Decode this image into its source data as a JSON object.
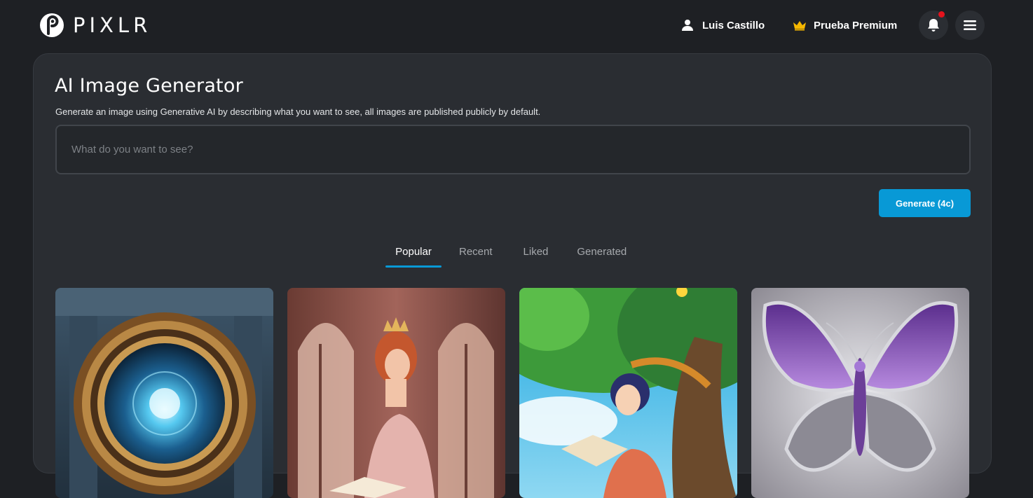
{
  "header": {
    "logo_text": "PIXLR",
    "user_name": "Luis Castillo",
    "premium_label": "Prueba Premium",
    "notification_indicator_color": "#e5131d",
    "icons": [
      "pixlr-logo-icon",
      "user-icon",
      "crown-icon",
      "bell-icon",
      "hamburger-menu-icon"
    ]
  },
  "generator": {
    "title": "AI Image Generator",
    "description": "Generate an image using Generative AI by describing what you want to see, all images are published publicly by default.",
    "prompt_value": "",
    "prompt_placeholder": "What do you want to see?",
    "generate_label": "Generate (4c)"
  },
  "tabs": [
    {
      "label": "Popular",
      "active": true
    },
    {
      "label": "Recent",
      "active": false
    },
    {
      "label": "Liked",
      "active": false
    },
    {
      "label": "Generated",
      "active": false
    }
  ],
  "gallery": [
    {
      "subject": "portal"
    },
    {
      "subject": "princess"
    },
    {
      "subject": "girl-reading"
    },
    {
      "subject": "butterfly"
    }
  ],
  "colors": {
    "accent": "#0899d6",
    "background": "#1e2024",
    "card": "#2a2d32",
    "premium_crown": "#f5b700"
  }
}
